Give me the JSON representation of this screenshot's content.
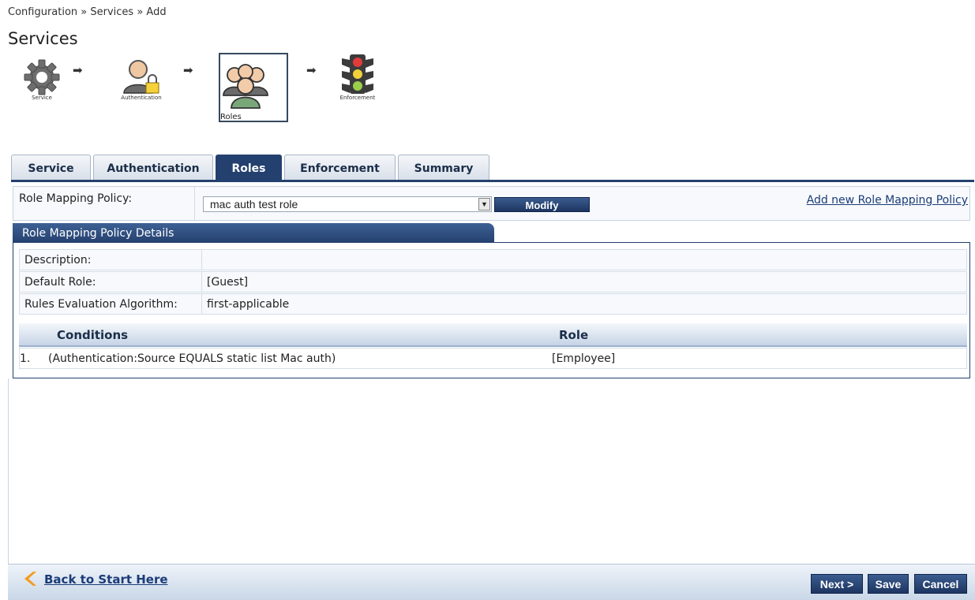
{
  "breadcrumb": "Configuration » Services » Add",
  "page_title": "Services",
  "wizard": {
    "steps": [
      {
        "label": "Service",
        "icon": "gear-icon"
      },
      {
        "label": "Authentication",
        "icon": "user-lock-icon"
      },
      {
        "label": "Roles",
        "icon": "group-icon"
      },
      {
        "label": "Enforcement",
        "icon": "traffic-light-icon"
      }
    ],
    "active": "Roles"
  },
  "tabs": [
    {
      "label": "Service",
      "active": false
    },
    {
      "label": "Authentication",
      "active": false
    },
    {
      "label": "Roles",
      "active": true
    },
    {
      "label": "Enforcement",
      "active": false
    },
    {
      "label": "Summary",
      "active": false
    }
  ],
  "policy": {
    "label": "Role Mapping Policy:",
    "selected": "mac auth test role",
    "modify_label": "Modify",
    "add_new_label": "Add new Role Mapping Policy"
  },
  "details": {
    "title": "Role Mapping Policy Details",
    "rows": [
      {
        "key": "Description:",
        "value": ""
      },
      {
        "key": "Default Role:",
        "value": "[Guest]"
      },
      {
        "key": "Rules Evaluation Algorithm:",
        "value": "first-applicable"
      }
    ],
    "grid": {
      "headers": [
        "Conditions",
        "Role"
      ],
      "rows": [
        {
          "num": "1.",
          "condition": "(Authentication:Source EQUALS static list Mac auth)",
          "role": "[Employee]"
        }
      ]
    }
  },
  "footer": {
    "back_label": "Back to Start Here",
    "next_label": "Next >",
    "save_label": "Save",
    "cancel_label": "Cancel"
  },
  "colors": {
    "accent": "#24406f",
    "link": "#1b3c78"
  }
}
